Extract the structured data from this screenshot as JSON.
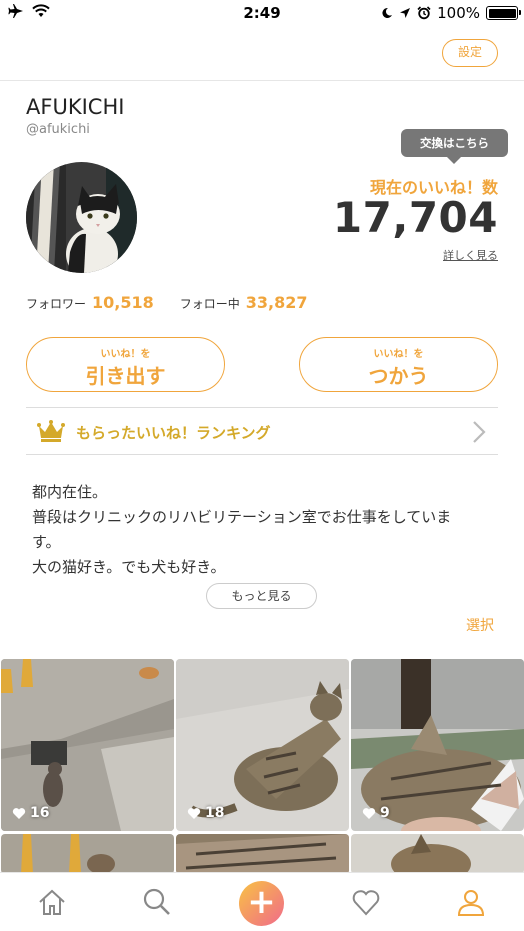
{
  "status_bar": {
    "time": "2:49",
    "battery": "100%"
  },
  "header": {
    "settings_label": "設定"
  },
  "profile": {
    "name": "AFUKICHI",
    "handle": "@afukichi",
    "exchange_tooltip": "交換はこちら",
    "likes_label": "現在のいいね！数",
    "likes_value": "17,704",
    "details_link": "詳しく見る",
    "followers_label": "フォロワー",
    "followers_count": "10,518",
    "following_label": "フォロー中",
    "following_count": "33,827"
  },
  "actions": {
    "withdraw_small": "いいね！を",
    "withdraw_big": "引き出す",
    "use_small": "いいね！を",
    "use_big": "つかう"
  },
  "ranking": {
    "label": "もらったいいね！ランキング"
  },
  "bio": {
    "lines": [
      "都内在住。",
      "普段はクリニックのリハビリテーション室でお仕事をしていま",
      "す。",
      "大の猫好き。でも犬も好き。"
    ],
    "more_label": "もっと見る",
    "select_label": "選択"
  },
  "posts": [
    {
      "likes": "16"
    },
    {
      "likes": "18"
    },
    {
      "likes": "9"
    }
  ],
  "tabbar": {
    "items": [
      "home-icon",
      "search-icon",
      "post-plus-icon",
      "heart-icon",
      "profile-icon"
    ],
    "plus_glyph": "+"
  },
  "colors": {
    "accent": "#f0a53c",
    "ranking_gold": "#d4a92a",
    "tooltip_bg": "#777777"
  }
}
